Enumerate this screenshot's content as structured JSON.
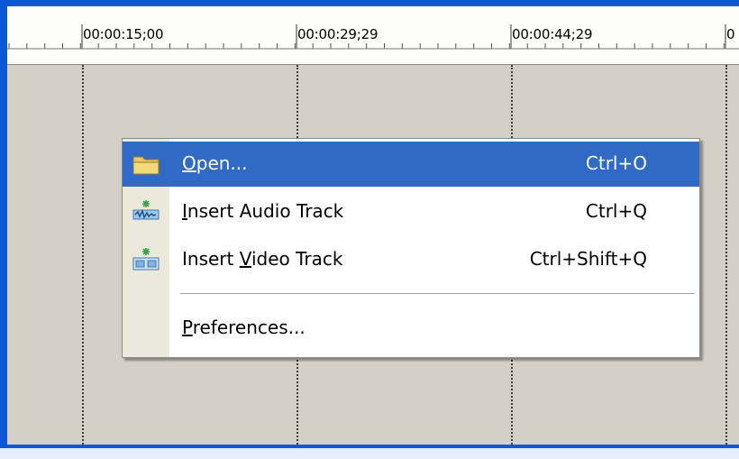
{
  "timeline": {
    "ruler_labels": [
      "00:00:15;00",
      "00:00:29;29",
      "00:00:44;29",
      "0"
    ]
  },
  "context_menu": {
    "items": [
      {
        "label": "Open...",
        "mnemonic_index": 0,
        "shortcut": "Ctrl+O",
        "icon": "folder-icon",
        "highlighted": true
      },
      {
        "label": "Insert Audio Track",
        "mnemonic_index": 0,
        "shortcut": "Ctrl+Q",
        "icon": "audio-track-icon",
        "highlighted": false
      },
      {
        "label": "Insert Video Track",
        "mnemonic_index": 7,
        "shortcut": "Ctrl+Shift+Q",
        "icon": "video-track-icon",
        "highlighted": false
      },
      {
        "label": "Preferences...",
        "mnemonic_index": 0,
        "shortcut": "",
        "icon": "",
        "highlighted": false
      }
    ]
  },
  "colors": {
    "window_frame": "#0a58d8",
    "timeline_background": "#d4d0c8",
    "menu_highlight": "#316ac5",
    "menu_gutter": "#ebe9dc"
  }
}
